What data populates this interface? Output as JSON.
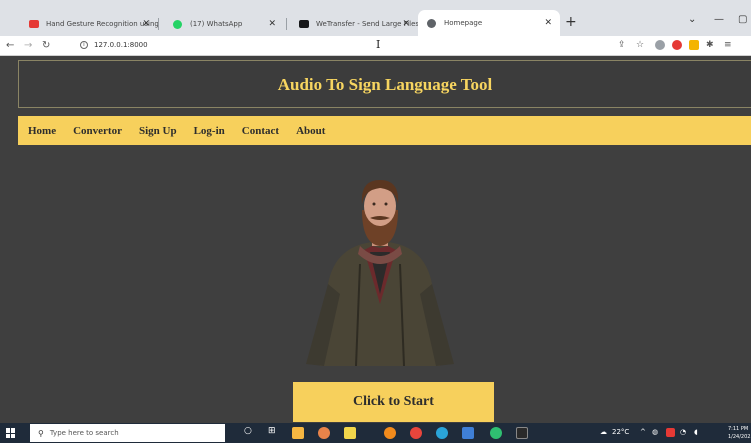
{
  "browser": {
    "tabs": [
      {
        "title": "Hand Gesture Recognition using",
        "color": "#e53935"
      },
      {
        "title": "(17) WhatsApp",
        "color": "#25d366"
      },
      {
        "title": "WeTransfer - Send Large Files &",
        "color": "#17181a"
      },
      {
        "title": "Homepage",
        "color": "#5f6368"
      }
    ],
    "url": "127.0.0.1:8000"
  },
  "site": {
    "title": "Audio To Sign Language Tool",
    "nav": [
      "Home",
      "Convertor",
      "Sign Up",
      "Log-in",
      "Contact",
      "About"
    ],
    "start_button": "Click to Start",
    "accent": "#f7d05c",
    "background": "#3f3f3f"
  },
  "taskbar": {
    "search_placeholder": "Type here to search",
    "weather": "22°C",
    "time": "7:11 PM",
    "date": "1/24/2023"
  }
}
